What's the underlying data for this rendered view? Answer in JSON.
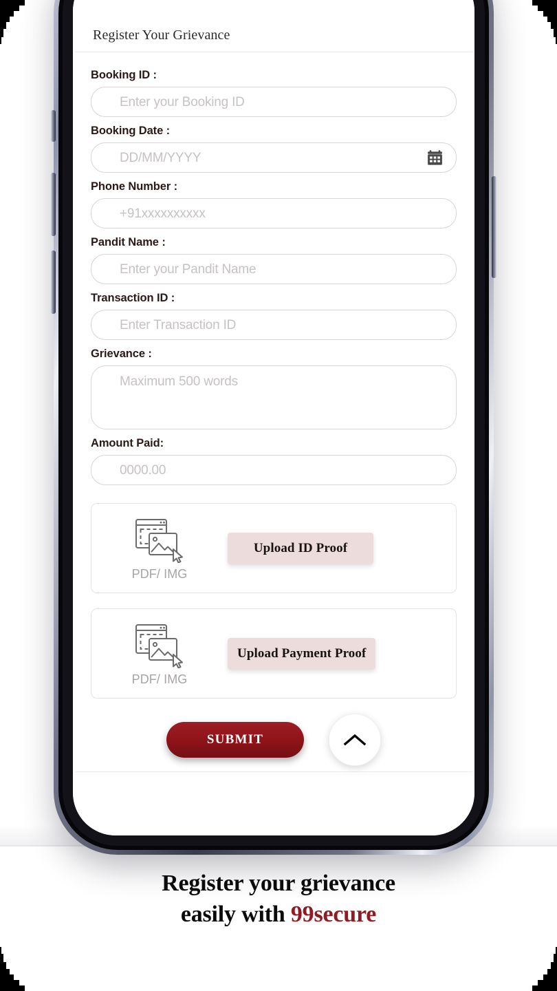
{
  "app": {
    "title": "Register Your Grievance",
    "fields": [
      {
        "label": "Booking ID :",
        "placeholder": "Enter your Booking ID",
        "name": "booking-id",
        "type": "text"
      },
      {
        "label": "Booking Date :",
        "placeholder": "DD/MM/YYYY",
        "name": "booking-date",
        "type": "date"
      },
      {
        "label": "Phone Number :",
        "placeholder": "+91xxxxxxxxxx",
        "name": "phone-number",
        "type": "tel"
      },
      {
        "label": "Pandit Name :",
        "placeholder": "Enter your Pandit Name",
        "name": "pandit-name",
        "type": "text"
      },
      {
        "label": "Transaction ID :",
        "placeholder": "Enter Transaction ID",
        "name": "transaction-id",
        "type": "text"
      },
      {
        "label": "Grievance :",
        "placeholder": "Maximum 500 words",
        "name": "grievance",
        "type": "textarea"
      },
      {
        "label": "Amount Paid:",
        "placeholder": "0000.00",
        "name": "amount-paid",
        "type": "number"
      }
    ],
    "uploads": [
      {
        "kind": "PDF/ IMG",
        "button": "Upload ID Proof",
        "name": "id-proof"
      },
      {
        "kind": "PDF/ IMG",
        "button": "Upload Payment Proof",
        "name": "payment-proof"
      }
    ],
    "submit_label": "SUBMIT",
    "scrolltop_icon": "chevron-up-icon",
    "calendar_icon": "calendar-icon",
    "upload_icon": "image-upload-cursor-icon"
  },
  "caption": {
    "line1": "Register your grievance",
    "line2_prefix": "easily with ",
    "brand": "99secure"
  },
  "colors": {
    "brand_red": "#8e1c22",
    "submit_red": "#8d1319",
    "upload_pink": "#eddcdc",
    "label_dark": "#2a1a17",
    "placeholder_gray": "#c6c2c4",
    "border_gray": "#d8d5d5"
  },
  "device": {
    "buttons": [
      "mute-switch",
      "volume-up",
      "volume-down",
      "power-button"
    ]
  }
}
